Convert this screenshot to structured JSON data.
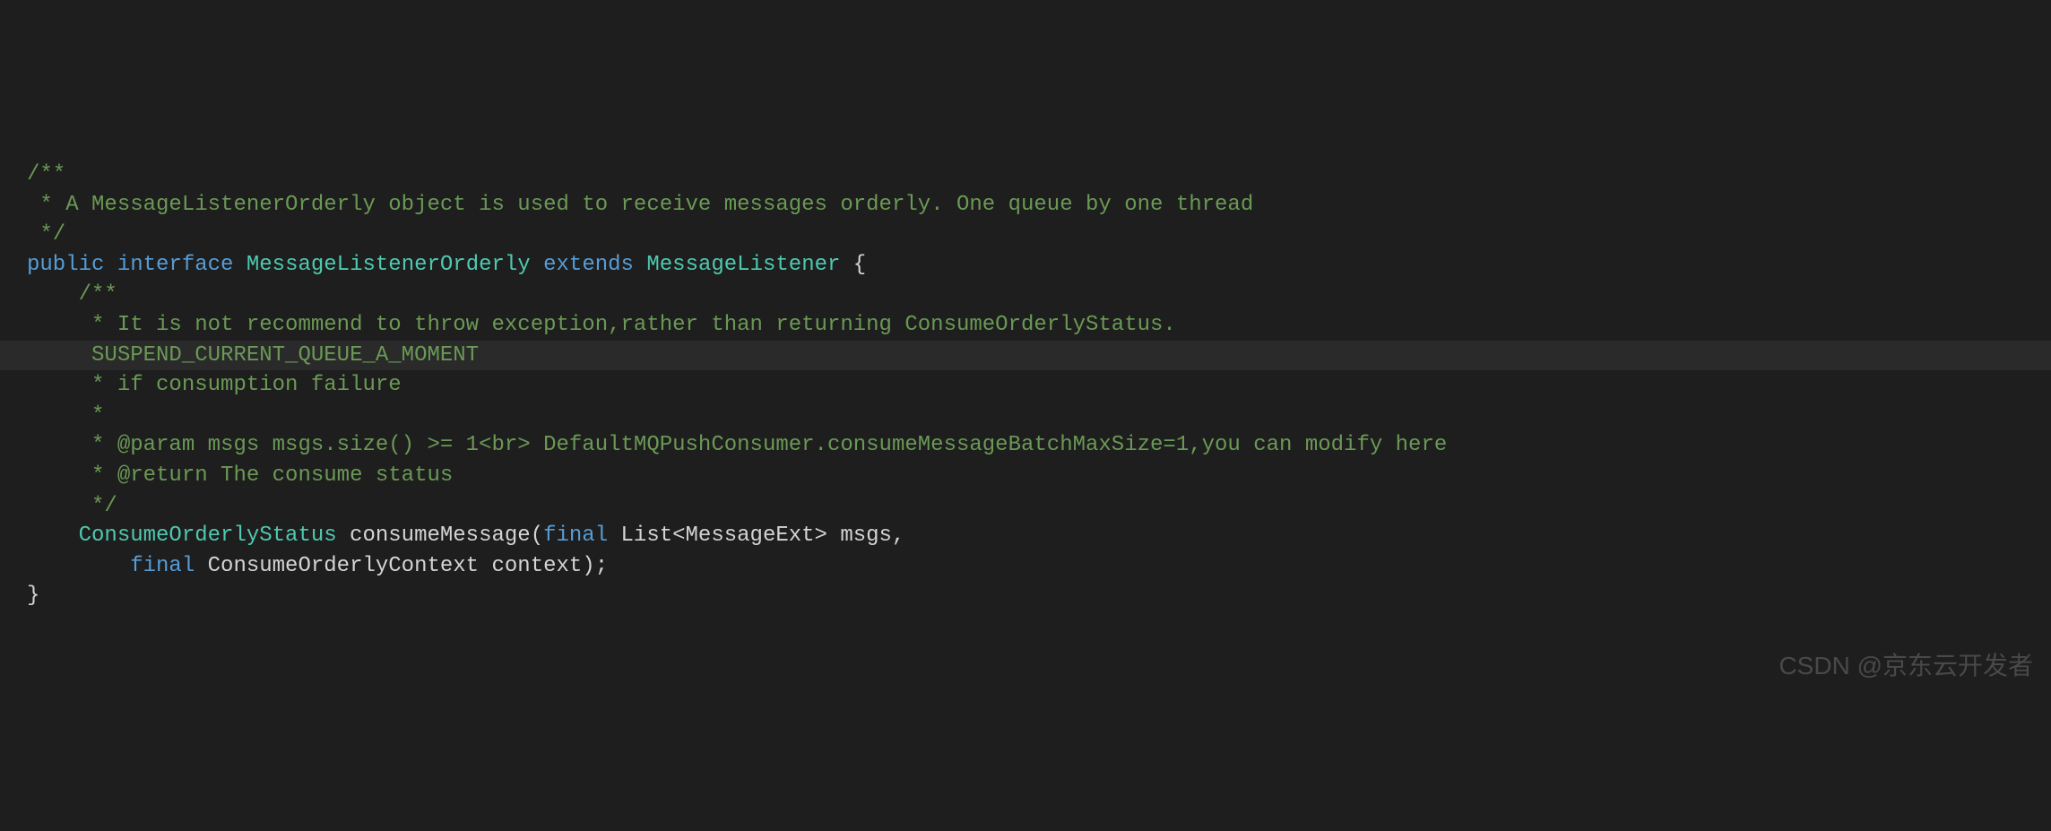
{
  "code": {
    "lines": [
      {
        "indent": "",
        "highlighted": false,
        "segments": [
          {
            "text": "/**",
            "class": "comment"
          }
        ]
      },
      {
        "indent": " ",
        "highlighted": false,
        "segments": [
          {
            "text": "* A MessageListenerOrderly object is used to receive messages orderly. One queue by one thread",
            "class": "comment"
          }
        ]
      },
      {
        "indent": " ",
        "highlighted": false,
        "segments": [
          {
            "text": "*/",
            "class": "comment"
          }
        ]
      },
      {
        "indent": "",
        "highlighted": false,
        "segments": [
          {
            "text": "public",
            "class": "keyword"
          },
          {
            "text": " ",
            "class": "plain"
          },
          {
            "text": "interface",
            "class": "keyword"
          },
          {
            "text": " ",
            "class": "plain"
          },
          {
            "text": "MessageListenerOrderly",
            "class": "type"
          },
          {
            "text": " ",
            "class": "plain"
          },
          {
            "text": "extends",
            "class": "keyword"
          },
          {
            "text": " ",
            "class": "plain"
          },
          {
            "text": "MessageListener",
            "class": "type"
          },
          {
            "text": " {",
            "class": "punctuation"
          }
        ]
      },
      {
        "indent": "    ",
        "highlighted": false,
        "segments": [
          {
            "text": "/**",
            "class": "comment"
          }
        ]
      },
      {
        "indent": "     ",
        "highlighted": false,
        "segments": [
          {
            "text": "* It is not recommend to throw exception,rather than returning ConsumeOrderlyStatus.",
            "class": "comment"
          }
        ]
      },
      {
        "indent": "     ",
        "highlighted": true,
        "segments": [
          {
            "text": "SUSPEND_CURRENT_QUEUE_A_MOMENT",
            "class": "comment"
          }
        ]
      },
      {
        "indent": "     ",
        "highlighted": false,
        "segments": [
          {
            "text": "* if consumption failure",
            "class": "comment"
          }
        ]
      },
      {
        "indent": "     ",
        "highlighted": false,
        "segments": [
          {
            "text": "*",
            "class": "comment"
          }
        ]
      },
      {
        "indent": "     ",
        "highlighted": false,
        "segments": [
          {
            "text": "* @param msgs msgs.size() >= 1<br> DefaultMQPushConsumer.consumeMessageBatchMaxSize=1,you can modify here",
            "class": "comment"
          }
        ]
      },
      {
        "indent": "     ",
        "highlighted": false,
        "segments": [
          {
            "text": "* @return The consume status",
            "class": "comment"
          }
        ]
      },
      {
        "indent": "     ",
        "highlighted": false,
        "segments": [
          {
            "text": "*/",
            "class": "comment"
          }
        ]
      },
      {
        "indent": "    ",
        "highlighted": false,
        "segments": [
          {
            "text": "ConsumeOrderlyStatus",
            "class": "type"
          },
          {
            "text": " consumeMessage(",
            "class": "plain"
          },
          {
            "text": "final",
            "class": "keyword"
          },
          {
            "text": " List<MessageExt> msgs,",
            "class": "plain"
          }
        ]
      },
      {
        "indent": "        ",
        "highlighted": false,
        "segments": [
          {
            "text": "final",
            "class": "keyword"
          },
          {
            "text": " ConsumeOrderlyContext context);",
            "class": "plain"
          }
        ]
      },
      {
        "indent": "",
        "highlighted": false,
        "segments": [
          {
            "text": "}",
            "class": "punctuation"
          }
        ]
      }
    ]
  },
  "watermark": "CSDN @京东云开发者"
}
